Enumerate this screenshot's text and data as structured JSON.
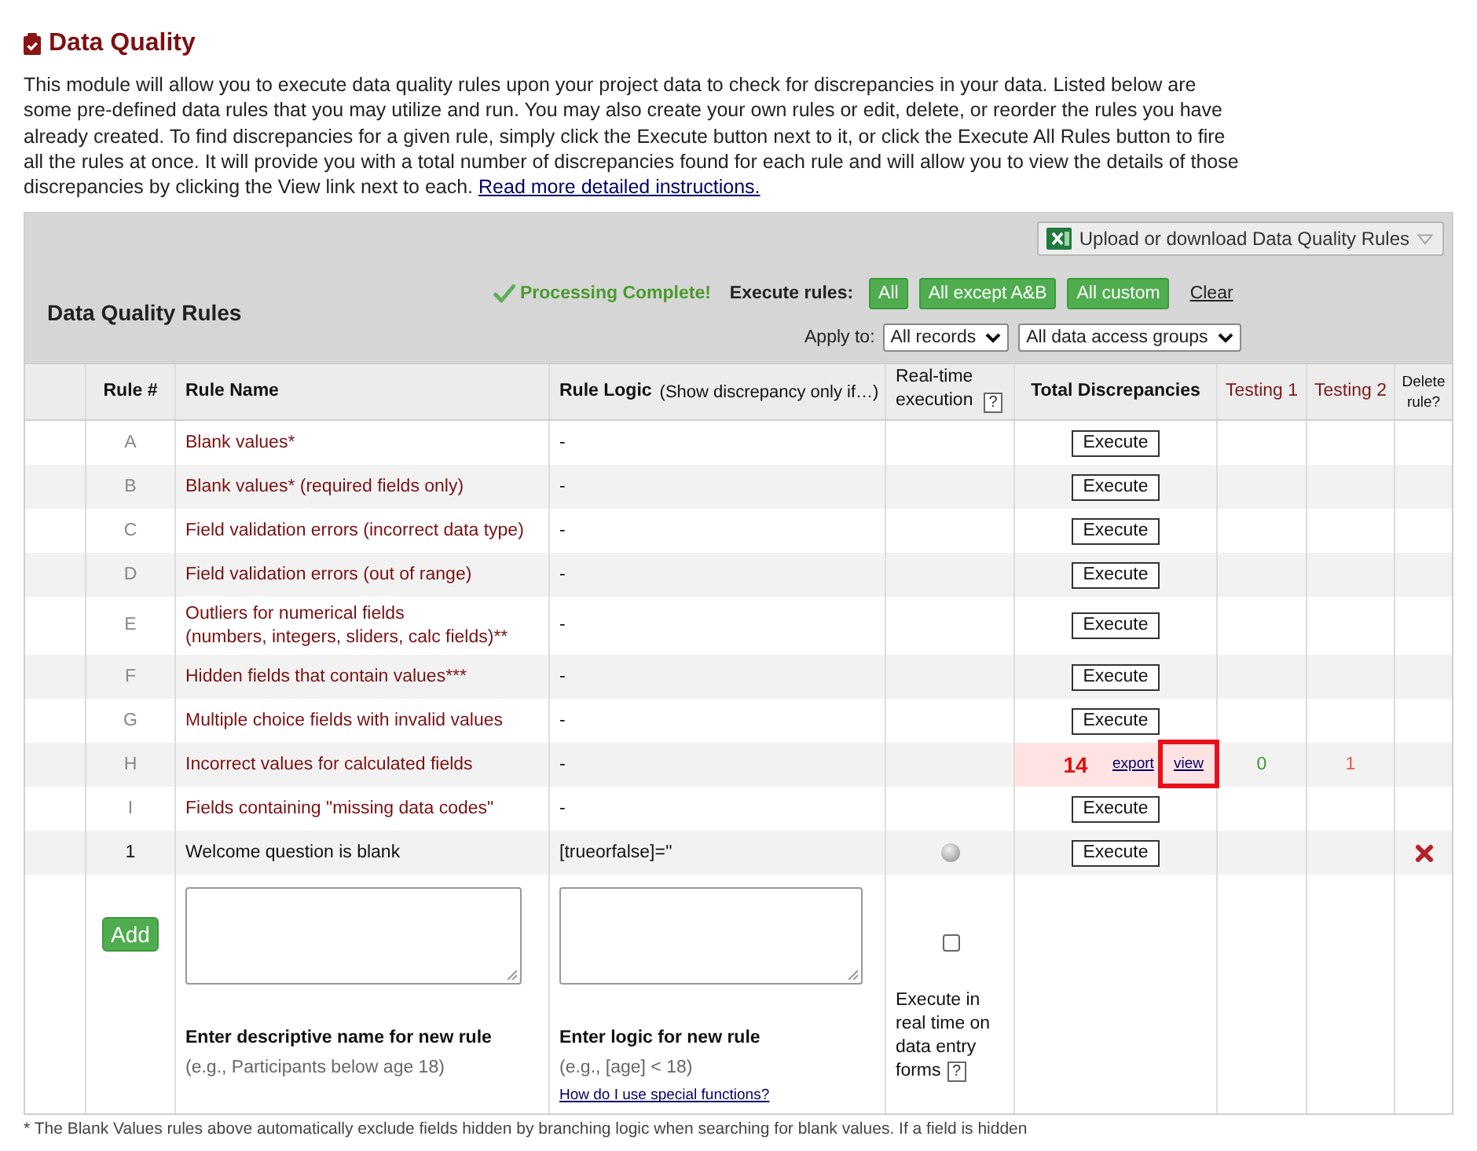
{
  "page": {
    "title": "Data Quality"
  },
  "intro": {
    "text": "This module will allow you to execute data quality rules upon your project data to check for discrepancies in your data. Listed below are some pre-defined data rules that you may utilize and run. You may also create your own rules or edit, delete, or reorder the rules you have already created. To find discrepancies for a given rule, simply click the Execute button next to it, or click the Execute All Rules button to fire all the rules at once. It will provide you with a total number of discrepancies found for each rule and will allow you to view the details of those discrepancies by clicking the View link next to each.",
    "link": "Read more detailed instructions."
  },
  "rules_panel": {
    "title": "Data Quality Rules",
    "upload_button": "Upload or download Data Quality Rules",
    "status": "Processing Complete!",
    "execute_label": "Execute rules:",
    "execute_buttons": [
      "All",
      "All except A&B",
      "All custom"
    ],
    "clear_link": "Clear",
    "apply_label": "Apply to:",
    "filters": [
      "All records",
      "All data access groups"
    ]
  },
  "table": {
    "columns": [
      {
        "kind": "bold",
        "label": "Rule #"
      },
      {
        "kind": "bold_left",
        "label": "Rule Name"
      },
      {
        "kind": "logic",
        "label": "Rule Logic",
        "note": "(Show discrepancy only if…)"
      },
      {
        "kind": "help",
        "label": "Real-time execution",
        "help": "?"
      },
      {
        "kind": "bold",
        "label": "Total Discrepancies"
      },
      {
        "kind": "accent",
        "label": "Testing 1"
      },
      {
        "kind": "accent",
        "label": "Testing 2"
      },
      {
        "kind": "small",
        "label": "Delete rule?"
      }
    ],
    "rows": [
      {
        "kind": "predefined",
        "number": "A",
        "name": "Blank values*",
        "logic": "-",
        "action": "Execute"
      },
      {
        "kind": "predefined",
        "number": "B",
        "name": "Blank values* (required fields only)",
        "logic": "-",
        "action": "Execute"
      },
      {
        "kind": "predefined",
        "number": "C",
        "name": "Field validation errors (incorrect data type)",
        "logic": "-",
        "action": "Execute"
      },
      {
        "kind": "predefined",
        "number": "D",
        "name": "Field validation errors (out of range)",
        "logic": "-",
        "action": "Execute"
      },
      {
        "kind": "predefined",
        "number": "E",
        "name": "Outliers for numerical fields",
        "name_note": "(numbers, integers, sliders, calc fields)**",
        "logic": "-",
        "action": "Execute"
      },
      {
        "kind": "predefined",
        "number": "F",
        "name": "Hidden fields that contain values***",
        "logic": "-",
        "action": "Execute"
      },
      {
        "kind": "predefined",
        "number": "G",
        "name": "Multiple choice fields with invalid values",
        "logic": "-",
        "action": "Execute"
      },
      {
        "kind": "predefined",
        "number": "H",
        "name": "Incorrect values for calculated fields",
        "logic": "-",
        "result": {
          "count": "14",
          "export": "export",
          "view": "view",
          "view_highlighted": true
        },
        "testing": [
          {
            "value": "0",
            "color": "#3c9a3c"
          },
          {
            "value": "1",
            "color": "#e0604c"
          }
        ]
      },
      {
        "kind": "predefined",
        "number": "I",
        "name": "Fields containing \"missing data codes\"",
        "logic": "-",
        "action": "Execute"
      },
      {
        "kind": "custom",
        "number": "1",
        "name": "Welcome question is blank",
        "logic": "[trueorfalse]=''",
        "real_time": false,
        "action": "Execute",
        "deletable": true
      }
    ]
  },
  "add_rule": {
    "button": "Add",
    "name_field": {
      "label": "Enter descriptive name for new rule",
      "hint": "(e.g., Participants below age 18)"
    },
    "logic_field": {
      "label": "Enter logic for new rule",
      "hint": "(e.g., [age] < 18)",
      "help_link": "How do I use special functions?"
    },
    "real_time": {
      "checked": false,
      "label": "Execute in real time on data entry",
      "label_end": "forms",
      "help": "?"
    }
  },
  "footnote": "* The Blank Values rules above automatically exclude fields hidden by branching logic when searching for blank values. If a field is hidden"
}
